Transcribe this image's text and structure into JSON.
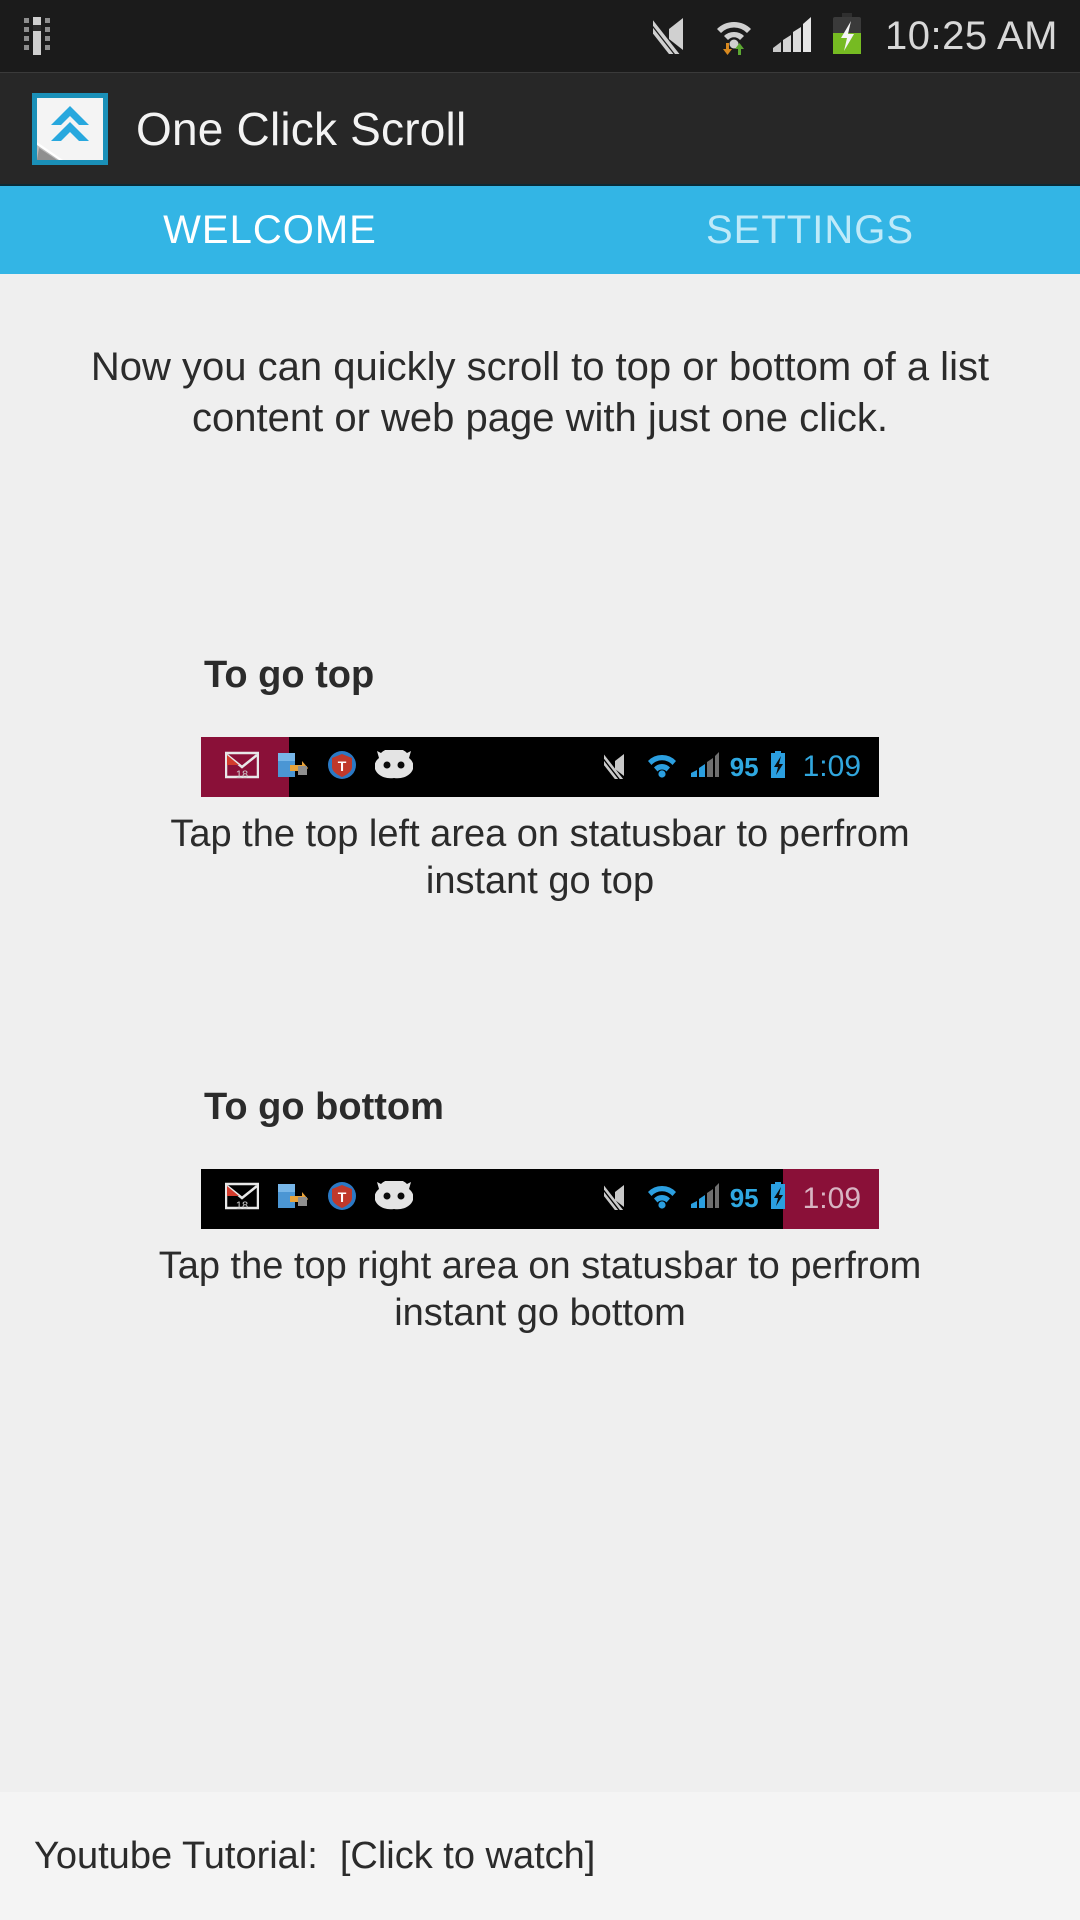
{
  "statusbar": {
    "clock": "10:25 AM",
    "icons": [
      {
        "name": "sim-card-icon"
      },
      {
        "name": "volume-mute-icon"
      },
      {
        "name": "wifi-icon"
      },
      {
        "name": "cell-signal-icon"
      },
      {
        "name": "battery-charging-icon"
      }
    ]
  },
  "appbar": {
    "title": "One Click Scroll",
    "icon_name": "double-chevron-up-icon",
    "icon_accent": "#1a90b8",
    "bg": "#272727"
  },
  "tabs": {
    "accent": "#33b5e5",
    "items": [
      {
        "label": "WELCOME",
        "active": true
      },
      {
        "label": "SETTINGS",
        "active": false
      }
    ]
  },
  "content": {
    "intro": "Now you can quickly scroll to top or bottom of a list content or web page with just one click.",
    "sections": [
      {
        "title": "To go top",
        "caption": "Tap the top left area on statusbar to perfrom instant go top",
        "highlight_side": "left",
        "highlight_color": "#8a1038"
      },
      {
        "title": "To go bottom",
        "caption": "Tap the top right area on statusbar to perfrom instant go bottom",
        "highlight_side": "right",
        "highlight_color": "#8a1038"
      }
    ],
    "mock_statusbar": {
      "battery_percent": "95",
      "clock": "1:09",
      "notification_icons": [
        {
          "name": "gmail-icon",
          "badge": "18"
        },
        {
          "name": "file-transfer-icon"
        },
        {
          "name": "shield-t-icon"
        },
        {
          "name": "cyanogenmod-icon"
        }
      ],
      "system_icons": [
        {
          "name": "volume-mute-icon"
        },
        {
          "name": "wifi-icon"
        },
        {
          "name": "cell-signal-icon"
        },
        {
          "name": "battery-charging-icon"
        }
      ]
    }
  },
  "footer": {
    "label": "Youtube Tutorial:",
    "link": "[Click to watch]"
  }
}
